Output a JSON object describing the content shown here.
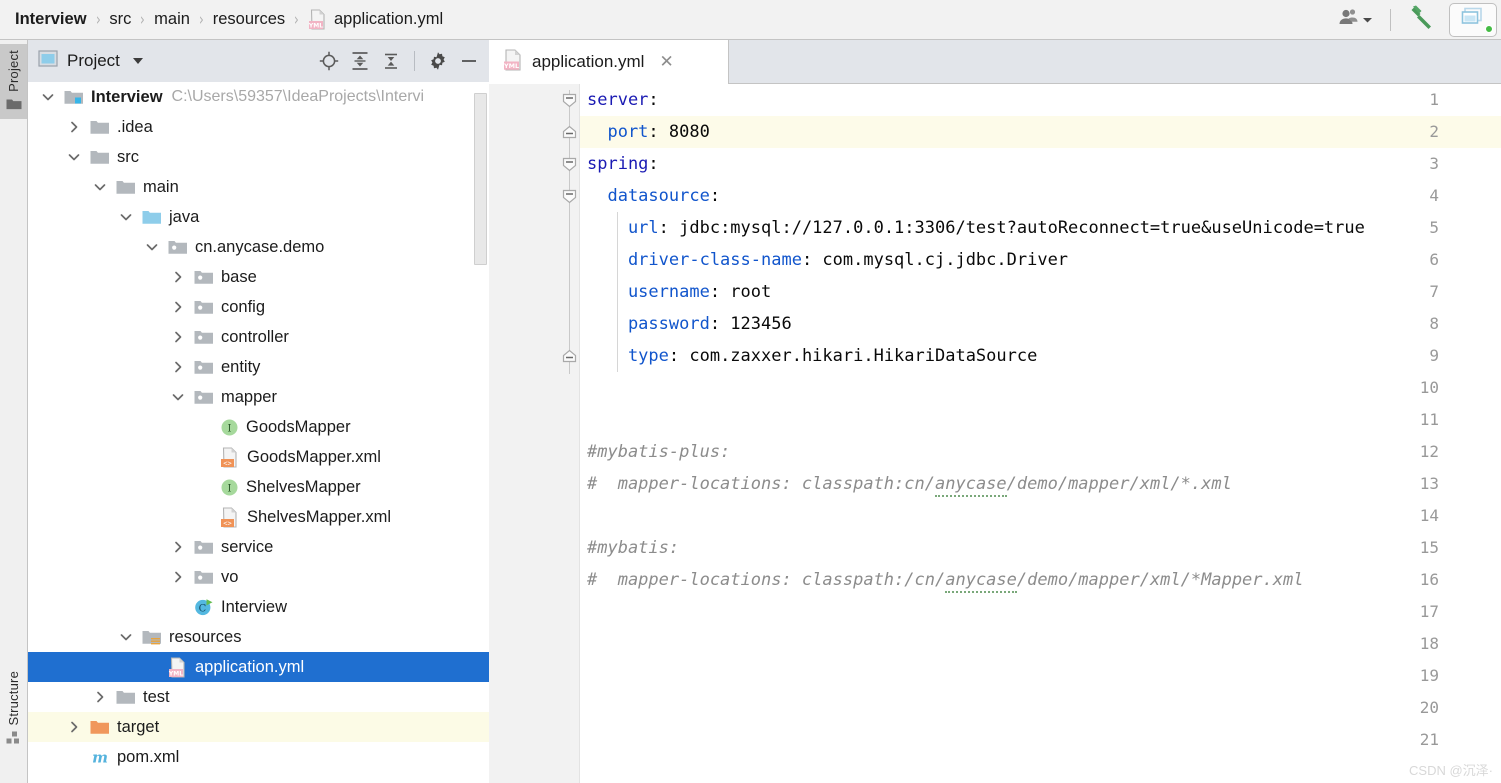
{
  "breadcrumb": {
    "items": [
      {
        "label": "Interview",
        "icon": "none",
        "root": true
      },
      {
        "label": "src",
        "icon": "none",
        "root": false
      },
      {
        "label": "main",
        "icon": "none",
        "root": false
      },
      {
        "label": "resources",
        "icon": "none",
        "root": false
      },
      {
        "label": "application.yml",
        "icon": "yml-file-icon",
        "root": false
      }
    ],
    "separator": "›"
  },
  "topbar_right": {
    "user_icon": "user-avatar-icon",
    "user_dropdown_icon": "chevron-down-icon",
    "build_icon": "hammer-build-icon",
    "preview_icon": "window-preview-icon",
    "preview_status_color": "#44bb44"
  },
  "toolstrip": {
    "project_label": "Project",
    "project_icon": "folder-icon",
    "structure_label": "Structure",
    "structure_icon": "structure-blocks-icon"
  },
  "project_panel": {
    "title": "Project",
    "dropdown_icon": "chevron-down-icon",
    "tools": [
      {
        "name": "locate-in-tree-icon",
        "label": "Select Opened File"
      },
      {
        "name": "expand-all-icon",
        "label": "Expand All"
      },
      {
        "name": "collapse-all-icon",
        "label": "Collapse All"
      },
      {
        "name": "settings-gear-icon",
        "label": "Settings"
      },
      {
        "name": "hide-panel-icon",
        "label": "Hide"
      }
    ],
    "tree": [
      {
        "label": "Interview",
        "path": "C:\\Users\\59357\\IdeaProjects\\Intervi",
        "indent": 0,
        "arrow": "down",
        "icon": "module-icon",
        "bold": true,
        "state": "normal"
      },
      {
        "label": ".idea",
        "path": "",
        "indent": 1,
        "arrow": "right",
        "icon": "folder-gray-icon",
        "bold": false,
        "state": "normal"
      },
      {
        "label": "src",
        "path": "",
        "indent": 1,
        "arrow": "down",
        "icon": "folder-gray-icon",
        "bold": false,
        "state": "normal"
      },
      {
        "label": "main",
        "path": "",
        "indent": 2,
        "arrow": "down",
        "icon": "folder-gray-icon",
        "bold": false,
        "state": "normal"
      },
      {
        "label": "java",
        "path": "",
        "indent": 3,
        "arrow": "down",
        "icon": "source-root-icon",
        "bold": false,
        "state": "normal"
      },
      {
        "label": "cn.anycase.demo",
        "path": "",
        "indent": 4,
        "arrow": "down",
        "icon": "package-icon",
        "bold": false,
        "state": "normal"
      },
      {
        "label": "base",
        "path": "",
        "indent": 5,
        "arrow": "right",
        "icon": "package-icon",
        "bold": false,
        "state": "normal"
      },
      {
        "label": "config",
        "path": "",
        "indent": 5,
        "arrow": "right",
        "icon": "package-icon",
        "bold": false,
        "state": "normal"
      },
      {
        "label": "controller",
        "path": "",
        "indent": 5,
        "arrow": "right",
        "icon": "package-icon",
        "bold": false,
        "state": "normal"
      },
      {
        "label": "entity",
        "path": "",
        "indent": 5,
        "arrow": "right",
        "icon": "package-icon",
        "bold": false,
        "state": "normal"
      },
      {
        "label": "mapper",
        "path": "",
        "indent": 5,
        "arrow": "down",
        "icon": "package-icon",
        "bold": false,
        "state": "normal"
      },
      {
        "label": "GoodsMapper",
        "path": "",
        "indent": 6,
        "arrow": "none",
        "icon": "java-interface-icon",
        "bold": false,
        "state": "normal"
      },
      {
        "label": "GoodsMapper.xml",
        "path": "",
        "indent": 6,
        "arrow": "none",
        "icon": "xml-file-icon",
        "bold": false,
        "state": "normal"
      },
      {
        "label": "ShelvesMapper",
        "path": "",
        "indent": 6,
        "arrow": "none",
        "icon": "java-interface-icon",
        "bold": false,
        "state": "normal"
      },
      {
        "label": "ShelvesMapper.xml",
        "path": "",
        "indent": 6,
        "arrow": "none",
        "icon": "xml-file-icon",
        "bold": false,
        "state": "normal"
      },
      {
        "label": "service",
        "path": "",
        "indent": 5,
        "arrow": "right",
        "icon": "package-icon",
        "bold": false,
        "state": "normal"
      },
      {
        "label": "vo",
        "path": "",
        "indent": 5,
        "arrow": "right",
        "icon": "package-icon",
        "bold": false,
        "state": "normal"
      },
      {
        "label": "Interview",
        "path": "",
        "indent": 5,
        "arrow": "none",
        "icon": "java-runnable-class-icon",
        "bold": false,
        "state": "normal"
      },
      {
        "label": "resources",
        "path": "",
        "indent": 3,
        "arrow": "down",
        "icon": "resource-root-icon",
        "bold": false,
        "state": "normal"
      },
      {
        "label": "application.yml",
        "path": "",
        "indent": 4,
        "arrow": "none",
        "icon": "yml-file-icon",
        "bold": false,
        "state": "selected"
      },
      {
        "label": "test",
        "path": "",
        "indent": 2,
        "arrow": "right",
        "icon": "folder-gray-icon",
        "bold": false,
        "state": "normal"
      },
      {
        "label": "target",
        "path": "",
        "indent": 1,
        "arrow": "right",
        "icon": "folder-excluded-icon",
        "bold": false,
        "state": "highlight"
      },
      {
        "label": "pom.xml",
        "path": "",
        "indent": 1,
        "arrow": "none",
        "icon": "maven-icon",
        "bold": false,
        "state": "normal"
      }
    ]
  },
  "editor": {
    "tab": {
      "label": "application.yml",
      "icon": "yml-file-icon",
      "close_icon": "close-icon",
      "active": true
    },
    "caret_line": 2,
    "total_lines": 21,
    "lines": [
      {
        "n": 1,
        "indent": 0,
        "fold": "start",
        "tokens": [
          {
            "t": "server",
            "c": "k1"
          },
          {
            "t": ":",
            "c": "val"
          }
        ]
      },
      {
        "n": 2,
        "indent": 1,
        "fold": "end",
        "tokens": [
          {
            "t": "  port",
            "c": "k2"
          },
          {
            "t": ": 8080",
            "c": "val"
          }
        ]
      },
      {
        "n": 3,
        "indent": 0,
        "fold": "start",
        "tokens": [
          {
            "t": "spring",
            "c": "k1"
          },
          {
            "t": ":",
            "c": "val"
          }
        ]
      },
      {
        "n": 4,
        "indent": 1,
        "fold": "start",
        "tokens": [
          {
            "t": "  datasource",
            "c": "k2"
          },
          {
            "t": ":",
            "c": "val"
          }
        ]
      },
      {
        "n": 5,
        "indent": 2,
        "fold": "none",
        "tokens": [
          {
            "t": "    url",
            "c": "k2"
          },
          {
            "t": ": jdbc:mysql://127.0.0.1:3306/test?autoReconnect=true&useUnicode=true",
            "c": "val"
          }
        ]
      },
      {
        "n": 6,
        "indent": 2,
        "fold": "none",
        "tokens": [
          {
            "t": "    driver-class-name",
            "c": "k2"
          },
          {
            "t": ": com.mysql.cj.jdbc.Driver",
            "c": "val"
          }
        ]
      },
      {
        "n": 7,
        "indent": 2,
        "fold": "none",
        "tokens": [
          {
            "t": "    username",
            "c": "k2"
          },
          {
            "t": ": root",
            "c": "val"
          }
        ]
      },
      {
        "n": 8,
        "indent": 2,
        "fold": "none",
        "tokens": [
          {
            "t": "    password",
            "c": "k2"
          },
          {
            "t": ": 123456",
            "c": "val"
          }
        ]
      },
      {
        "n": 9,
        "indent": 2,
        "fold": "end",
        "tokens": [
          {
            "t": "    type",
            "c": "k2"
          },
          {
            "t": ": com.zaxxer.hikari.HikariDataSource",
            "c": "val"
          }
        ]
      },
      {
        "n": 10,
        "indent": 0,
        "fold": "none",
        "tokens": []
      },
      {
        "n": 11,
        "indent": 0,
        "fold": "none",
        "tokens": []
      },
      {
        "n": 12,
        "indent": 0,
        "fold": "none",
        "tokens": [
          {
            "t": "#mybatis-plus:",
            "c": "cmt"
          }
        ]
      },
      {
        "n": 13,
        "indent": 0,
        "fold": "none",
        "tokens": [
          {
            "t": "#  mapper-locations: classpath:cn/",
            "c": "cmt"
          },
          {
            "t": "anycase",
            "c": "cmt squig"
          },
          {
            "t": "/demo/mapper/xml/*.xml",
            "c": "cmt"
          }
        ]
      },
      {
        "n": 14,
        "indent": 0,
        "fold": "none",
        "tokens": []
      },
      {
        "n": 15,
        "indent": 0,
        "fold": "none",
        "tokens": [
          {
            "t": "#mybatis:",
            "c": "cmt"
          }
        ]
      },
      {
        "n": 16,
        "indent": 0,
        "fold": "none",
        "tokens": [
          {
            "t": "#  mapper-locations: classpath:/cn/",
            "c": "cmt"
          },
          {
            "t": "anycase",
            "c": "cmt squig"
          },
          {
            "t": "/demo/mapper/xml/*Mapper.xml",
            "c": "cmt"
          }
        ]
      },
      {
        "n": 17,
        "indent": 0,
        "fold": "none",
        "tokens": []
      },
      {
        "n": 18,
        "indent": 0,
        "fold": "none",
        "tokens": []
      },
      {
        "n": 19,
        "indent": 0,
        "fold": "none",
        "tokens": []
      },
      {
        "n": 20,
        "indent": 0,
        "fold": "none",
        "tokens": []
      },
      {
        "n": 21,
        "indent": 0,
        "fold": "none",
        "tokens": []
      }
    ]
  },
  "watermark": "CSDN @沉泽·",
  "colors": {
    "selection_blue": "#1f6fd0",
    "highlight_yellow": "#fcfbe6",
    "caret_line": "#fdfbe9",
    "key_top": "#1a1ab3",
    "key_nested": "#1155cc",
    "comment": "#8c8c8c",
    "panel_header": "#e2e5ea",
    "topbar": "#f2f2f2"
  }
}
